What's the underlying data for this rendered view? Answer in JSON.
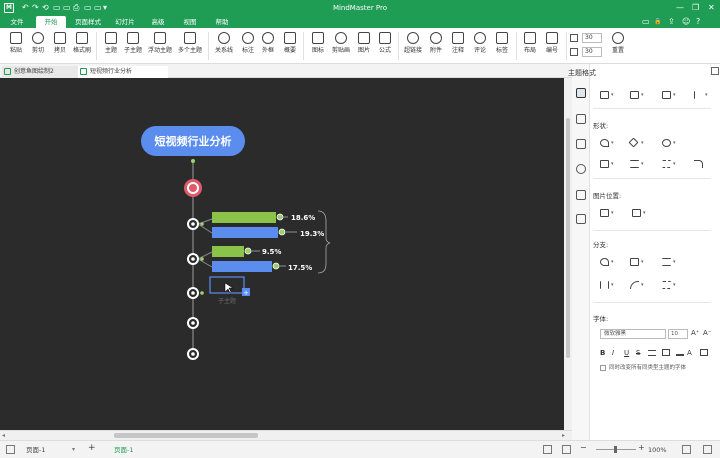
{
  "titlebar": {
    "logo": "M",
    "app_title": "MindMaster Pro",
    "quick_access": [
      "↶",
      "↷",
      "⟲",
      "▭",
      "▭",
      "⎙",
      "▭",
      "▭",
      "▾"
    ],
    "window_controls": [
      "—",
      "❐",
      "✕"
    ]
  },
  "menubar": {
    "items": [
      "文件",
      "开始",
      "页面样式",
      "幻灯片",
      "高级",
      "视图",
      "帮助"
    ],
    "active": "开始",
    "right_icons": [
      "▭",
      "🔒",
      "⇪",
      "☺",
      "?"
    ]
  },
  "ribbon": {
    "buttons": [
      {
        "label": "粘贴",
        "icon": "paste-icon"
      },
      {
        "label": "剪切",
        "icon": "cut-icon"
      },
      {
        "label": "拷贝",
        "icon": "copy-icon"
      },
      {
        "label": "格式刷",
        "icon": "format-painter-icon"
      },
      {
        "label": "主题",
        "icon": "topic-icon"
      },
      {
        "label": "子主题",
        "icon": "subtopic-icon"
      },
      {
        "label": "浮动主题",
        "icon": "floating-topic-icon"
      },
      {
        "label": "多个主题",
        "icon": "multiple-topics-icon"
      },
      {
        "label": "关系线",
        "icon": "relationship-icon"
      },
      {
        "label": "标注",
        "icon": "callout-icon"
      },
      {
        "label": "外框",
        "icon": "boundary-icon"
      },
      {
        "label": "概要",
        "icon": "summary-icon"
      },
      {
        "label": "图标",
        "icon": "icon-library-icon"
      },
      {
        "label": "剪贴画",
        "icon": "clipart-icon"
      },
      {
        "label": "图片",
        "icon": "image-icon"
      },
      {
        "label": "公式",
        "icon": "formula-icon"
      },
      {
        "label": "超链接",
        "icon": "hyperlink-icon"
      },
      {
        "label": "附件",
        "icon": "attachment-icon"
      },
      {
        "label": "注释",
        "icon": "note-icon"
      },
      {
        "label": "评论",
        "icon": "comment-icon"
      },
      {
        "label": "标签",
        "icon": "tag-icon"
      },
      {
        "label": "布局",
        "icon": "layout-icon"
      },
      {
        "label": "编号",
        "icon": "numbering-icon"
      },
      {
        "label": "重置",
        "icon": "reset-icon"
      }
    ],
    "spacing_h": "30",
    "spacing_v": "30"
  },
  "doc_tabs": [
    "创意鱼图绘制2",
    "短视频行业分析"
  ],
  "mindmap": {
    "root": "短视频行业分析",
    "percentages": [
      "18.6%",
      "19.3%",
      "9.5%",
      "17.5%"
    ],
    "bar_levels": [
      0.186,
      0.193,
      0.095,
      0.175
    ],
    "bar_colors": [
      "#8bc34a",
      "#5b8def",
      "#8bc34a",
      "#5b8def"
    ],
    "edit_hint": "子主题"
  },
  "panel": {
    "title": "主题格式",
    "shape_label": "形状:",
    "image_position_label": "图片位置:",
    "branch_label": "分支:",
    "font_label": "字体:",
    "font_name": "微软雅黑",
    "font_size": "10",
    "format_buttons": [
      "B",
      "I",
      "U",
      "S"
    ],
    "apply_all_label": "同时改变所有同类型主题的字体"
  },
  "statusbar": {
    "page_selector": "页面-1",
    "add_page": "+",
    "current_page": "页面-1",
    "zoom": "100%"
  }
}
